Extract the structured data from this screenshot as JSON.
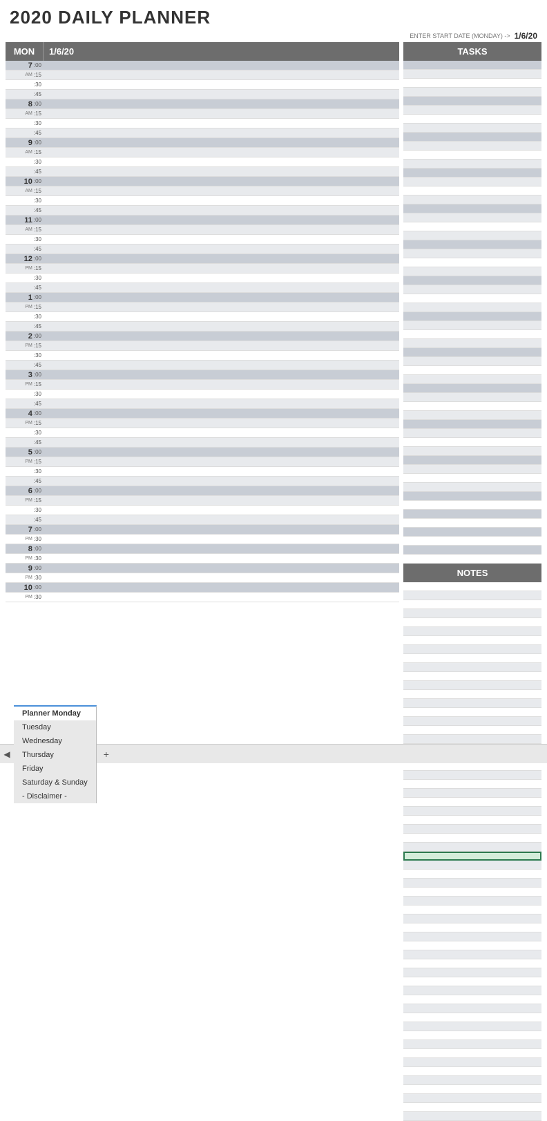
{
  "title": "2020 DAILY PLANNER",
  "start_date_label": "ENTER START DATE (MONDAY) ->",
  "start_date_value": "1/6/20",
  "header": {
    "day": "MON",
    "date": "1/6/20"
  },
  "tasks_label": "TASKS",
  "notes_label": "NOTES",
  "hours": [
    {
      "hour": "7",
      "ampm": "AM"
    },
    {
      "hour": "8",
      "ampm": "AM"
    },
    {
      "hour": "9",
      "ampm": "AM"
    },
    {
      "hour": "10",
      "ampm": "AM"
    },
    {
      "hour": "11",
      "ampm": "AM"
    },
    {
      "hour": "12",
      "ampm": "PM"
    },
    {
      "hour": "1",
      "ampm": "PM"
    },
    {
      "hour": "2",
      "ampm": "PM"
    },
    {
      "hour": "3",
      "ampm": "PM"
    },
    {
      "hour": "4",
      "ampm": "PM"
    },
    {
      "hour": "5",
      "ampm": "PM"
    },
    {
      "hour": "6",
      "ampm": "PM"
    },
    {
      "hour": "7",
      "ampm": "PM",
      "no15": true,
      "no45": true
    },
    {
      "hour": "8",
      "ampm": "PM",
      "no15": true,
      "no45": true
    },
    {
      "hour": "9",
      "ampm": "PM",
      "no15": true,
      "no45": true
    },
    {
      "hour": "10",
      "ampm": "PM",
      "no15": true,
      "no45": true
    }
  ],
  "tabs": [
    {
      "label": "Planner Monday",
      "active": true
    },
    {
      "label": "Tuesday",
      "active": false
    },
    {
      "label": "Wednesday",
      "active": false
    },
    {
      "label": "Thursday",
      "active": false
    },
    {
      "label": "Friday",
      "active": false
    },
    {
      "label": "Saturday & Sunday",
      "active": false
    },
    {
      "label": "- Disclaimer -",
      "active": false
    }
  ]
}
